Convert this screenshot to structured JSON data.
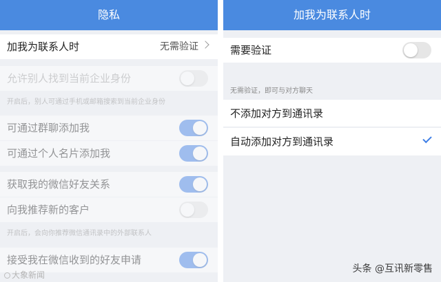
{
  "left": {
    "title": "隐私",
    "rows": [
      {
        "label": "加我为联系人时",
        "value": "无需验证"
      },
      {
        "label": "允许别人找到当前企业身份",
        "toggle": false
      },
      {
        "label": "可通过群聊添加我",
        "toggle": true
      },
      {
        "label": "可通过个人名片添加我",
        "toggle": true
      },
      {
        "label": "获取我的微信好友关系",
        "toggle": true
      },
      {
        "label": "向我推荐新的客户",
        "toggle": false
      },
      {
        "label": "接受我在微信收到的好友申请",
        "toggle": true
      }
    ],
    "notes": [
      "开启后，别人可通过手机或邮箱搜索到当前企业身份",
      "开启后，会向你推荐微信通讯录中的外部联系人"
    ]
  },
  "right": {
    "title": "加我为联系人时",
    "verify_label": "需要验证",
    "verify_toggle": false,
    "section_note": "无需验证，即可与对方聊天",
    "options": [
      {
        "label": "不添加对方到通讯录",
        "selected": false
      },
      {
        "label": "自动添加对方到通讯录",
        "selected": true
      }
    ]
  },
  "watermarks": {
    "left": "大象新闻",
    "right": "头条 @互讯新零售"
  },
  "colors": {
    "nav": "#4a8ae0",
    "toggle_on": "#3f7fe6",
    "toggle_off": "#e6e6e6",
    "background": "#eef0f4"
  }
}
